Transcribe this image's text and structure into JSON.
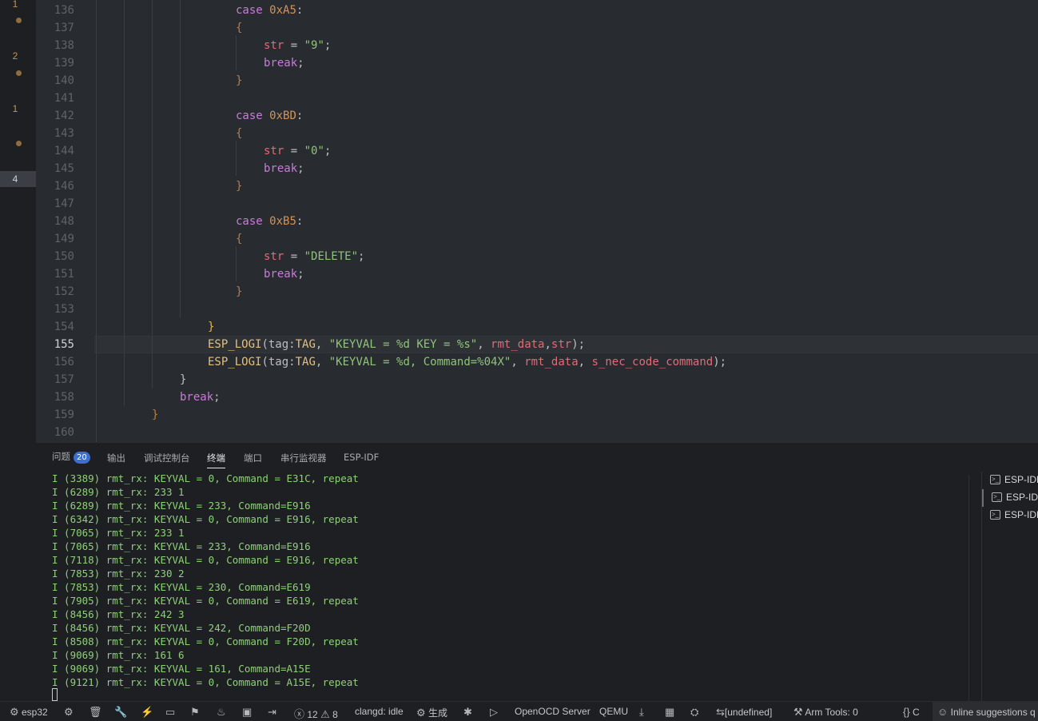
{
  "left_strip": {
    "counts": [
      "1",
      "2",
      "1"
    ],
    "active_count": "4"
  },
  "editor": {
    "line_numbers": [
      "136",
      "137",
      "138",
      "139",
      "140",
      "141",
      "142",
      "143",
      "144",
      "145",
      "146",
      "147",
      "148",
      "149",
      "150",
      "151",
      "152",
      "153",
      "154",
      "155",
      "156",
      "157",
      "158",
      "159",
      "160"
    ],
    "current_line": "155",
    "code": {
      "case1_kw": "case",
      "case1_val": "0xA5",
      "str1_var": "str",
      "str1_val": "\"9\"",
      "case2_kw": "case",
      "case2_val": "0xBD",
      "str2_var": "str",
      "str2_val": "\"0\"",
      "case3_kw": "case",
      "case3_val": "0xB5",
      "str3_var": "str",
      "str3_val": "\"DELETE\"",
      "break_kw": "break",
      "logi1_fn": "ESP_LOGI",
      "logi1_tag_label": "tag:",
      "logi1_tag": "TAG",
      "logi1_fmt": "\"KEYVAL = %d KEY = %s\"",
      "logi1_arg1": "rmt_data",
      "logi1_arg2": "str",
      "logi2_fn": "ESP_LOGI",
      "logi2_tag_label": "tag:",
      "logi2_tag": "TAG",
      "logi2_fmt": "\"KEYVAL = %d, Command=%04X\"",
      "logi2_arg1": "rmt_data",
      "logi2_arg2": "s_nec_code_command"
    }
  },
  "panel": {
    "tabs": [
      {
        "label": "问题",
        "badge": "20"
      },
      {
        "label": "输出"
      },
      {
        "label": "调试控制台"
      },
      {
        "label": "终端"
      },
      {
        "label": "端口"
      },
      {
        "label": "串行监视器"
      },
      {
        "label": "ESP-IDF"
      }
    ],
    "active_tab": "终端",
    "terminal_lines": [
      "I (3389) rmt_rx: KEYVAL = 0, Command = E31C, repeat",
      "I (6289) rmt_rx: 233 1",
      "I (6289) rmt_rx: KEYVAL = 233, Command=E916",
      "I (6342) rmt_rx: KEYVAL = 0, Command = E916, repeat",
      "I (7065) rmt_rx: 233 1",
      "I (7065) rmt_rx: KEYVAL = 233, Command=E916",
      "I (7118) rmt_rx: KEYVAL = 0, Command = E916, repeat",
      "I (7853) rmt_rx: 230 2",
      "I (7853) rmt_rx: KEYVAL = 230, Command=E619",
      "I (7905) rmt_rx: KEYVAL = 0, Command = E619, repeat",
      "I (8456) rmt_rx: 242 3",
      "I (8456) rmt_rx: KEYVAL = 242, Command=F20D",
      "I (8508) rmt_rx: KEYVAL = 0, Command = F20D, repeat",
      "I (9069) rmt_rx: 161 6",
      "I (9069) rmt_rx: KEYVAL = 161, Command=A15E",
      "I (9121) rmt_rx: KEYVAL = 0, Command = A15E, repeat"
    ],
    "terminal_list": [
      "ESP-IDF",
      "ESP-IDF",
      "ESP-IDF"
    ]
  },
  "status_bar": {
    "target": "esp32",
    "errors": "12",
    "warnings": "8",
    "clangd": "clangd: idle",
    "build": "生成",
    "openocd": "OpenOCD Server",
    "qemu": "QEMU",
    "undefined": "[undefined]",
    "arm_tools": "Arm Tools: 0",
    "lang": "C",
    "inline_suggestions": "Inline suggestions q"
  }
}
